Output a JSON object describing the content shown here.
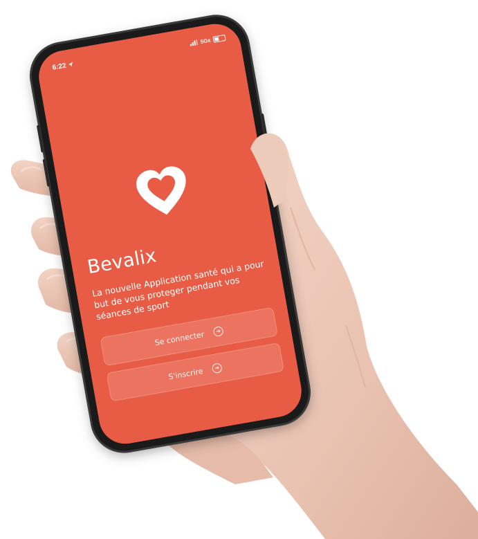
{
  "status_bar": {
    "time": "6:22",
    "network": "5Gᴇ"
  },
  "app": {
    "name": "Bevalix",
    "tagline": "La nouvelle Application santé qui a pour but de vous proteger pendant vos séances de sport",
    "login_label": "Se connecter",
    "signup_label": "S'inscrire"
  },
  "colors": {
    "screen_bg": "#e85c45",
    "text": "#ffffff"
  },
  "icons": {
    "logo": "heart-icon",
    "button_arrow": "arrow-circle-right-icon",
    "location": "location-arrow-icon"
  }
}
